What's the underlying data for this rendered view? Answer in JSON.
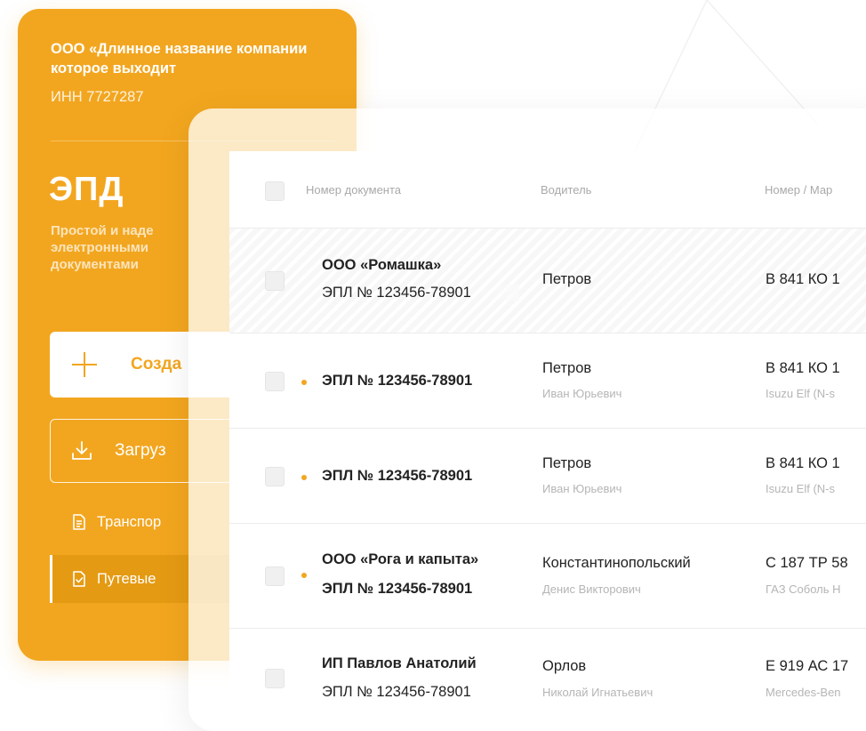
{
  "sidebar": {
    "company_name": "ООО «Длинное название компании которое выходит",
    "inn": "ИНН 7727287",
    "product_title": "ЭПД",
    "product_desc": "Простой и наде электронными документами",
    "create_label": "Созда",
    "upload_label": "Загруз",
    "nav": [
      {
        "label": "Транспор",
        "icon": "document-icon"
      },
      {
        "label": "Путевые",
        "icon": "document-check-icon"
      }
    ],
    "accent": "#f2a61f"
  },
  "table": {
    "headers": {
      "document": "Номер документа",
      "driver": "Водитель",
      "vehicle": "Номер / Мар"
    },
    "rows": [
      {
        "org": "ООО «Ромашка»",
        "doc": "ЭПЛ № 123456-78901",
        "driver_last": "Петров",
        "driver_first": "",
        "vehicle_plate": "В 841 КО 1",
        "vehicle_model": "",
        "status_dot": false
      },
      {
        "org": "",
        "doc": "ЭПЛ № 123456-78901",
        "driver_last": "Петров",
        "driver_first": "Иван Юрьевич",
        "vehicle_plate": "В 841 КО 1",
        "vehicle_model": "Isuzu Elf (N-s",
        "status_dot": true
      },
      {
        "org": "",
        "doc": "ЭПЛ № 123456-78901",
        "driver_last": "Петров",
        "driver_first": "Иван Юрьевич",
        "vehicle_plate": "В 841 КО 1",
        "vehicle_model": "Isuzu Elf (N-s",
        "status_dot": true
      },
      {
        "org": "ООО «Рога и капыта»",
        "doc": "ЭПЛ № 123456-78901",
        "driver_last": "Константинопольский",
        "driver_first": "Денис Викторович",
        "vehicle_plate": "С 187 ТР 58",
        "vehicle_model": "ГАЗ Соболь Н",
        "status_dot": true
      },
      {
        "org": "ИП Павлов Анатолий",
        "doc": "ЭПЛ № 123456-78901",
        "driver_last": "Орлов",
        "driver_first": "Николай Игнатьевич",
        "vehicle_plate": "Е 919 АС 17",
        "vehicle_model": "Mercedes-Ben",
        "status_dot": false
      }
    ]
  }
}
